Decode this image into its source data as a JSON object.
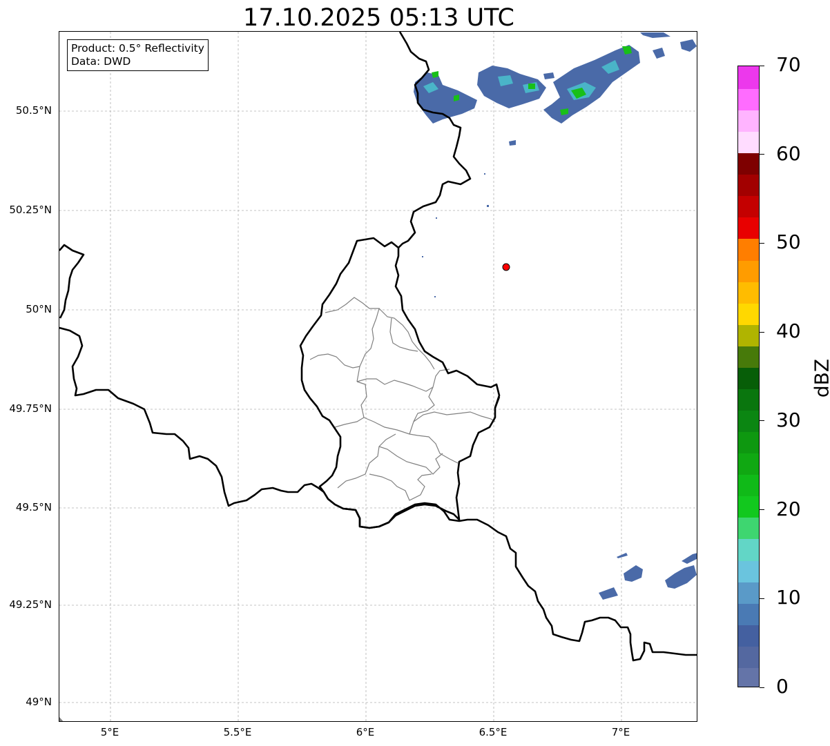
{
  "title": "17.10.2025 05:13 UTC",
  "infobox": {
    "product": "Product: 0.5° Reflectivity",
    "source": "Data: DWD"
  },
  "axes": {
    "lat_labels": [
      "50.5°N",
      "50.25°N",
      "50°N",
      "49.75°N",
      "49.5°N",
      "49.25°N",
      "49°N"
    ],
    "lon_labels": [
      "5°E",
      "5.5°E",
      "6°E",
      "6.5°E",
      "7°E"
    ]
  },
  "colorbar": {
    "label": "dBZ",
    "ticks": [
      "0",
      "10",
      "20",
      "30",
      "40",
      "50",
      "60",
      "70"
    ],
    "colors": [
      "#6474a8",
      "#5468a0",
      "#4460a0",
      "#4a7ab4",
      "#5a9ac8",
      "#6ac4de",
      "#62d6c6",
      "#3ed670",
      "#12c81e",
      "#10ba18",
      "#10a812",
      "#0e9810",
      "#0b8612",
      "#0a760e",
      "#075e08",
      "#477a0a",
      "#b0b400",
      "#ffd800",
      "#ffbc00",
      "#ff9c00",
      "#ff7e00",
      "#e80000",
      "#c40000",
      "#a20000",
      "#7e0000",
      "#ffdcff",
      "#ffb4ff",
      "#ff6cff",
      "#ec38ec"
    ]
  },
  "station": {
    "name": "radar-site",
    "color": "#ff0000"
  },
  "colors": {
    "border": "#000000",
    "province": "#808080",
    "gridline": "#b0b0b0",
    "echo_light": "#4a6aa8",
    "echo_mid": "#4ab4c8",
    "echo_strong": "#18c018"
  }
}
